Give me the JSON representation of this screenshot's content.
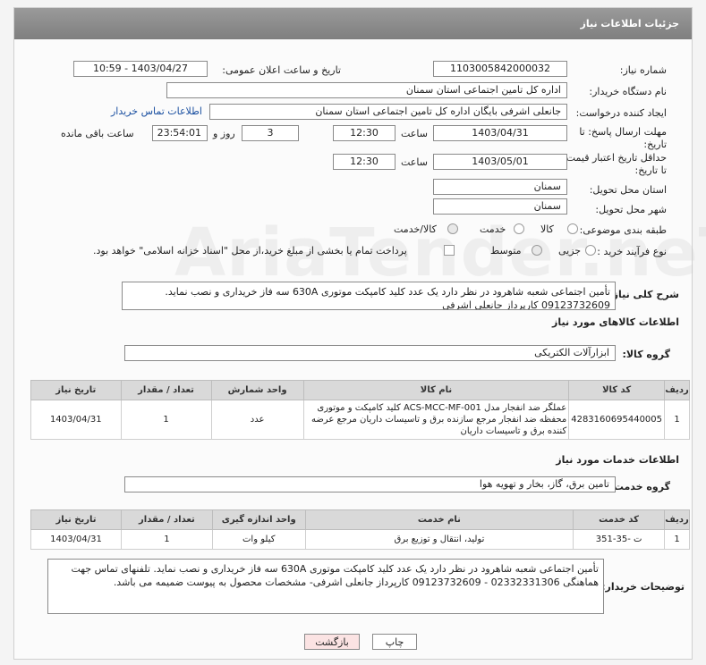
{
  "header": {
    "title": "جزئیات اطلاعات نیاز"
  },
  "fields": {
    "need_number_label": "شماره نیاز:",
    "need_number": "1103005842000032",
    "announce_label": "تاریخ و ساعت اعلان عمومی:",
    "announce_value": "1403/04/27 - 10:59",
    "buyer_org_label": "نام دستگاه خریدار:",
    "buyer_org": "اداره کل تامین اجتماعی استان سمنان",
    "creator_label": "ایجاد کننده درخواست:",
    "creator": "جانعلی  اشرفی  بایگان  اداره کل تامین اجتماعی استان سمنان",
    "contact_link": "اطلاعات تماس خریدار",
    "deadline_label": "مهلت ارسال پاسخ: تا تاریخ:",
    "deadline_date": "1403/04/31",
    "time_label": "ساعت",
    "deadline_time": "12:30",
    "days_value": "3",
    "days_label": "روز و",
    "remaining_time": "23:54:01",
    "remaining_label": "ساعت باقی مانده",
    "validity_label": "حداقل تاریخ اعتبار قیمت: تا تاریخ:",
    "validity_date": "1403/05/01",
    "validity_time": "12:30",
    "province_label": "استان محل تحویل:",
    "province": "سمنان",
    "city_label": "شهر محل تحویل:",
    "city": "سمنان",
    "category_label": "طبقه بندی موضوعی:",
    "category_options": [
      "کالا",
      "خدمت",
      "کالا/خدمت"
    ],
    "process_label": "نوع فرآیند خرید :",
    "process_options": [
      "جزیی",
      "متوسط"
    ],
    "payment_note": "پرداخت تمام یا بخشی از مبلغ خرید،از محل \"اسناد خزانه اسلامی\" خواهد بود."
  },
  "summary": {
    "label": "شرح کلی نیاز:",
    "text": "تأمین اجتماعی شعبه شاهرود در نظر  دارد یک عدد کلید کامپکت موتوری 630A سه فاز خریداری و نصب نماید. 09123732609 کارپرداز جانعلی اشرفی"
  },
  "goods": {
    "section_title": "اطلاعات کالاهای مورد نیاز",
    "group_label": "گروه کالا:",
    "group_value": "ابزارآلات الکتریکی",
    "headers": [
      "ردیف",
      "کد کالا",
      "نام کالا",
      "واحد شمارش",
      "تعداد / مقدار",
      "تاریخ نیاز"
    ],
    "rows": [
      [
        "1",
        "4283160695440005",
        "عملگر ضد انفجار مدل ACS-MCC-MF-001 کلید کامپکت و موتوری محفظه ضد انفجار مرجع سازنده برق و تاسیسات داریان مرجع عرضه کننده برق و تاسیسات داریان",
        "عدد",
        "1",
        "1403/04/31"
      ]
    ]
  },
  "services": {
    "section_title": "اطلاعات خدمات مورد نیاز",
    "group_label": "گروه خدمت:",
    "group_value": "تامین برق، گاز، بخار و تهویه هوا",
    "headers": [
      "ردیف",
      "کد خدمت",
      "نام خدمت",
      "واحد اندازه گیری",
      "تعداد / مقدار",
      "تاریخ نیاز"
    ],
    "rows": [
      [
        "1",
        "ت -35-351",
        "تولید، انتقال و توزیع برق",
        "کیلو وات",
        "1",
        "1403/04/31"
      ]
    ]
  },
  "buyer_notes": {
    "label": "توضیحات خریدار:",
    "text": "تأمین اجتماعی شعبه شاهرود در نظر  دارد یک عدد کلید کامپکت موتوری 630A سه فاز خریداری و نصب نماید. تلفنهای تماس جهت هماهنگی 02332331306 - 09123732609 کارپرداز جانعلی اشرفی- مشخصات محصول به پیوست ضمیمه می باشد."
  },
  "buttons": {
    "print": "چاپ",
    "back": "بازگشت"
  },
  "watermark": "AriaTender.neT"
}
